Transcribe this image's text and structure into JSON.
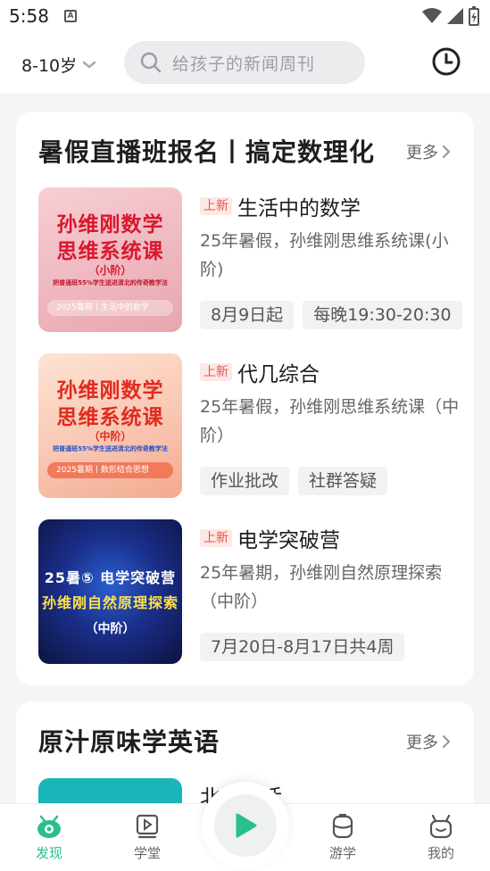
{
  "status": {
    "time": "5:58"
  },
  "header": {
    "age": "8-10岁",
    "search_placeholder": "给孩子的新闻周刊"
  },
  "section1": {
    "title": "暑假直播班报名丨搞定数理化",
    "more": "更多",
    "courses": [
      {
        "badge": "上新",
        "name": "生活中的数学",
        "desc": "25年暑假，孙维刚思维系统课(小阶)",
        "tags": [
          "8月9日起",
          "每晚19:30-20:30"
        ],
        "thumb": {
          "line1": "孙维刚数学",
          "line2": "思维系统课",
          "stage": "（小阶）",
          "tagline": "把普通班55%学生送进清北的传奇教学法",
          "footer": "2025暑期丨生活中的数学"
        }
      },
      {
        "badge": "上新",
        "name": "代几综合",
        "desc": "25年暑假，孙维刚思维系统课（中阶）",
        "tags": [
          "作业批改",
          "社群答疑"
        ],
        "thumb": {
          "line1": "孙维刚数学",
          "line2": "思维系统课",
          "stage": "（中阶）",
          "tagline": "把普通班55%学生送进清北的传奇教学法",
          "footer": "2025暑期丨数形结合思想"
        }
      },
      {
        "badge": "上新",
        "name": "电学突破营",
        "desc": "25年暑期，孙维刚自然原理探索（中阶）",
        "tags": [
          "7月20日-8月17日共4周"
        ],
        "thumb": {
          "line1": "25暑⑤ 电学突破营",
          "line2": "孙维刚自然原理探索",
          "stage": "（中阶）"
        }
      }
    ]
  },
  "section2": {
    "title": "原汁原味学英语",
    "more": "更多",
    "first_item": "北美生活"
  },
  "tabs": [
    {
      "label": "发现",
      "icon": "discover-icon",
      "active": true
    },
    {
      "label": "学堂",
      "icon": "video-course-icon"
    },
    {
      "label": "游学",
      "icon": "backpack-icon"
    },
    {
      "label": "我的",
      "icon": "robot-profile-icon"
    }
  ],
  "colors": {
    "accent": "#2bbf8a",
    "badge_red": "#e8534a",
    "card_bg": "#ffffff",
    "page_bg": "#f4f5f7"
  }
}
